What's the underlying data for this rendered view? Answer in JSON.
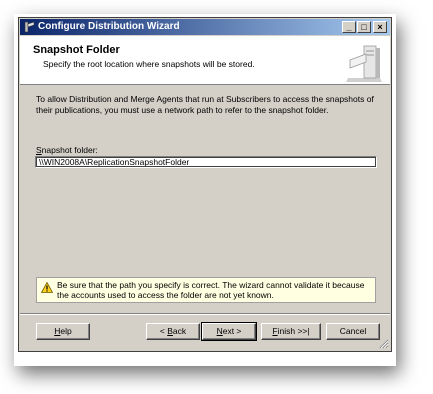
{
  "window": {
    "title": "Configure Distribution Wizard"
  },
  "header": {
    "title": "Snapshot Folder",
    "subtitle": "Specify the root location where snapshots will be stored."
  },
  "body": {
    "description": "To allow Distribution and Merge Agents that run at Subscribers to access the snapshots of their publications, you must use a network path to refer to the snapshot folder.",
    "field_label_hotkey": "S",
    "field_label_rest": "napshot folder:",
    "field_value": "\\\\WIN2008A\\ReplicationSnapshotFolder"
  },
  "warning": {
    "icon": "warning-icon",
    "text": "Be sure that the path you specify is correct. The wizard cannot validate it because the accounts used to access the folder are not yet known."
  },
  "buttons": {
    "help_hotkey": "H",
    "help_rest": "elp",
    "back_prefix": "< ",
    "back_hotkey": "B",
    "back_rest": "ack",
    "next_hotkey": "N",
    "next_rest": "ext >",
    "finish_hotkey": "F",
    "finish_rest": "inish >>|",
    "cancel": "Cancel"
  },
  "colors": {
    "titlebar_start": "#0a246a",
    "titlebar_end": "#a6caf0",
    "dialog_bg": "#d4d0c8",
    "warning_bg": "#ffffe1"
  }
}
